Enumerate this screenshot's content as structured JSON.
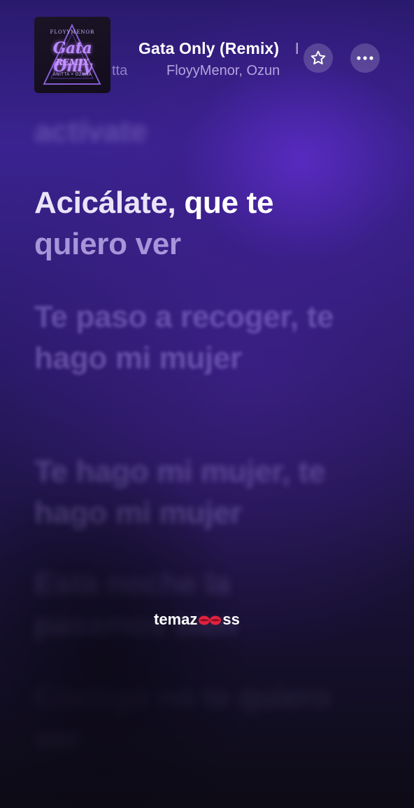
{
  "now_playing": {
    "artwork": {
      "top_text": "FLOYYMENOR",
      "title": "Gata Only",
      "subtitle": "REMIX",
      "credits": "ANITTA × OZUNA"
    },
    "title": "Gata Only (Remix)",
    "title_tail": "I",
    "artist_prev": "tta",
    "artist": "FloyyMenor, Ozun"
  },
  "actions": {
    "favorite_icon": "star-icon",
    "more_icon": "ellipsis-icon"
  },
  "lyrics": {
    "previous": "actívate",
    "current": {
      "sung": "Acicálate,",
      "singing": " que te",
      "line2": "quiero ver"
    },
    "upcoming": [
      "Te paso a recoger, te hago mi mujer",
      "Te hago mi mujer, te hago mi mujer",
      "Esta noche la pasamos bien",
      "Contigo no te quiero ver"
    ]
  },
  "watermark": {
    "before": "temaz",
    "after": "ss",
    "icon": "kiss-lips-icon"
  },
  "colors": {
    "accent_purple": "#5b2cc8",
    "background_dark": "#0c0a16"
  }
}
